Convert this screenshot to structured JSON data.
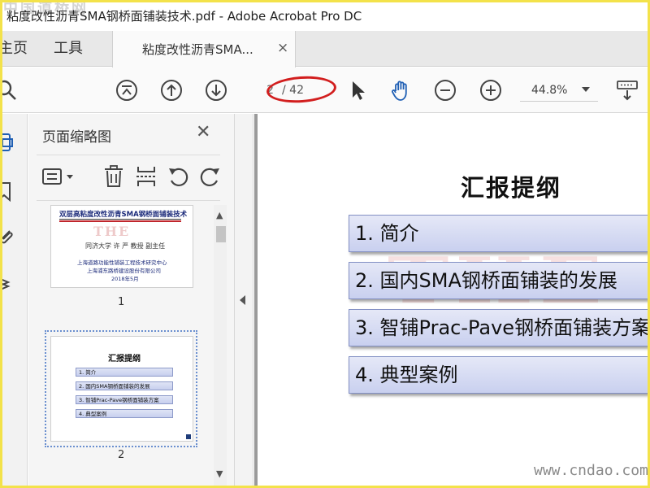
{
  "window": {
    "watermark_top": "中国道桥网",
    "title": "粘度改性沥青SMA钢桥面铺装技术.pdf - Adobe Acrobat Pro DC"
  },
  "tabs": {
    "home": "主页",
    "tools": "工具",
    "document": "粘度改性沥青SMA...",
    "close": "×"
  },
  "toolbar": {
    "current_page": "2",
    "total_pages": "/ 42",
    "zoom": "44.8%"
  },
  "thumbnails_panel": {
    "title": "页面缩略图",
    "close": "✕",
    "pages": [
      {
        "number": "1",
        "title": "双层高粘度改性沥青SMA钢桥面铺装技术",
        "logo_text": "THE",
        "author": "同济大学 许 严 教授 副主任",
        "org1": "上海道路功能性铺装工程技术研究中心",
        "org2": "上海浦东路桥建设股份有限公司",
        "date": "2018年5月"
      },
      {
        "number": "2",
        "title": "汇报提纲",
        "items": [
          "1. 简介",
          "2. 国内SMA钢桥面铺装的发展",
          "3. 智铺Prac-Pave钢桥面铺装方案",
          "4. 典型案例"
        ]
      }
    ]
  },
  "document": {
    "heading": "汇报提纲",
    "watermark": "THE",
    "items": [
      "1. 简介",
      "2. 国内SMA钢桥面铺装的发展",
      "3. 智铺Prac-Pave钢桥面铺装方案",
      "4. 典型案例"
    ],
    "site_watermark": "www.cndao.com"
  },
  "colors": {
    "frame": "#f3e24a",
    "annotation_ellipse": "#d21e1e",
    "accent_blue": "#1f5fb4",
    "outline_box": "#c9d0ef"
  },
  "icons": [
    "search-icon",
    "first-page-icon",
    "prev-page-icon",
    "next-page-icon",
    "select-arrow-icon",
    "hand-tool-icon",
    "zoom-out-icon",
    "zoom-in-icon",
    "keyboard-icon",
    "thumbnails-icon",
    "bookmark-icon",
    "attachment-icon",
    "layers-icon",
    "page-options-icon",
    "delete-icon",
    "insert-icon",
    "rotate-ccw-icon",
    "rotate-cw-icon"
  ]
}
